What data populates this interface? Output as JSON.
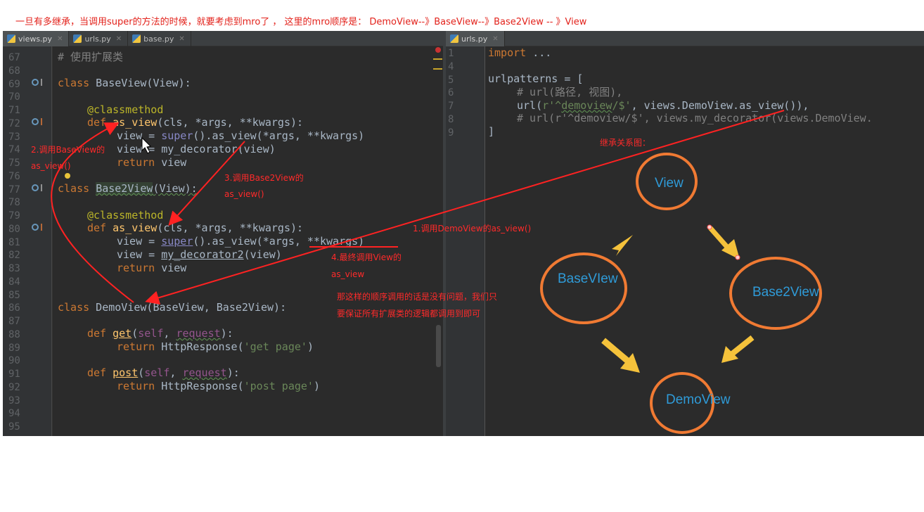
{
  "caption": "一旦有多继承，当调用super的方法的时候，就要考虑到mro了 ， 这里的mro顺序是： DemoView--》BaseView--》Base2View -- 》View",
  "tabs_left": [
    {
      "label": "views.py",
      "active": true
    },
    {
      "label": "urls.py",
      "active": false
    },
    {
      "label": "base.py",
      "active": false
    }
  ],
  "tabs_right": [
    {
      "label": "urls.py",
      "active": true
    }
  ],
  "left_line_numbers": [
    "67",
    "68",
    "69",
    "70",
    "71",
    "72",
    "73",
    "74",
    "75",
    "76",
    "77",
    "78",
    "79",
    "80",
    "81",
    "82",
    "83",
    "84",
    "85",
    "86",
    "87",
    "88",
    "89",
    "90",
    "91",
    "92",
    "93",
    "94",
    "95"
  ],
  "right_line_numbers": [
    "1",
    "4",
    "5",
    "6",
    "7",
    "8",
    "9"
  ],
  "code_left": {
    "l67": "# 使用扩展类",
    "l69_kw": "class",
    "l69_rest": " BaseView(View):",
    "l71": "@classmethod",
    "l72_kw": "def",
    "l72_fn": "as_view",
    "l72_rest": "(cls, *args, **kwargs):",
    "l73_a": "view = ",
    "l73_b": "super",
    "l73_c": "().as_view(*args, **kwargs)",
    "l74": "view = my_decorator(view)",
    "l75_kw": "return",
    "l75_rest": " view",
    "l77_kw": "class",
    "l77_name": "Base2View",
    "l77_rest": "(View):",
    "l79": "@classmethod",
    "l80_kw": "def",
    "l80_fn": "as_view",
    "l80_rest": "(cls, *args, **kwargs):",
    "l81_a": "view = ",
    "l81_b": "super",
    "l81_c": "().as_view(*args, **kwargs)",
    "l82_a": "view = ",
    "l82_b": "my_decorator2",
    "l82_c": "(view)",
    "l83_kw": "return",
    "l83_rest": " view",
    "l86_kw": "class",
    "l86_rest": " DemoView(BaseView, Base2View):",
    "l88_kw": "def",
    "l88_fn": "get",
    "l88_p1": "(",
    "l88_self": "self",
    "l88_p2": ", ",
    "l88_req": "request",
    "l88_p3": "):",
    "l89_kw": "return",
    "l89_a": " HttpResponse(",
    "l89_str": "'get page'",
    "l89_b": ")",
    "l91_kw": "def",
    "l91_fn": "post",
    "l91_p1": "(",
    "l91_self": "self",
    "l91_p2": ", ",
    "l91_req": "request",
    "l91_p3": "):",
    "l92_kw": "return",
    "l92_a": " HttpResponse(",
    "l92_str": "'post page'",
    "l92_b": ")"
  },
  "code_right": {
    "r1_kw": "import",
    "r1_rest": " ...",
    "r5": "urlpatterns = [",
    "r6": "# url(路径, 视图),",
    "r7_a": "url(",
    "r7_str1": "r'^",
    "r7_str2": "demoview",
    "r7_str3": "/$'",
    "r7_b": ", views.DemoView.as_view()),",
    "r8": "# url(r'^demoview/$', views.my_decorator(views.DemoView.",
    "r9": "]"
  },
  "notes": {
    "n1": "1.调用DemoView的as_view()",
    "n2a": "2.调用BaseView的",
    "n2b": "as_view()",
    "n3a": "3.调用Base2View的",
    "n3b": "as_view()",
    "n4a": "4.最终调用View的",
    "n4b": "as_view",
    "summary1": "那这样的顺序调用的话是没有问题，我们只",
    "summary2": "要保证所有扩展类的逻辑都调用到即可",
    "diagram_title": "继承关系图："
  },
  "diagram": {
    "view": "View",
    "baseview": "BaseVIew",
    "base2view": "Base2View",
    "demoview": "DemoView"
  },
  "colors": {
    "note_red": "#ff2a2a",
    "circle_orange": "#f07a33",
    "arrow_yellow": "#f5c23b",
    "label_blue": "#2f9bd8"
  }
}
